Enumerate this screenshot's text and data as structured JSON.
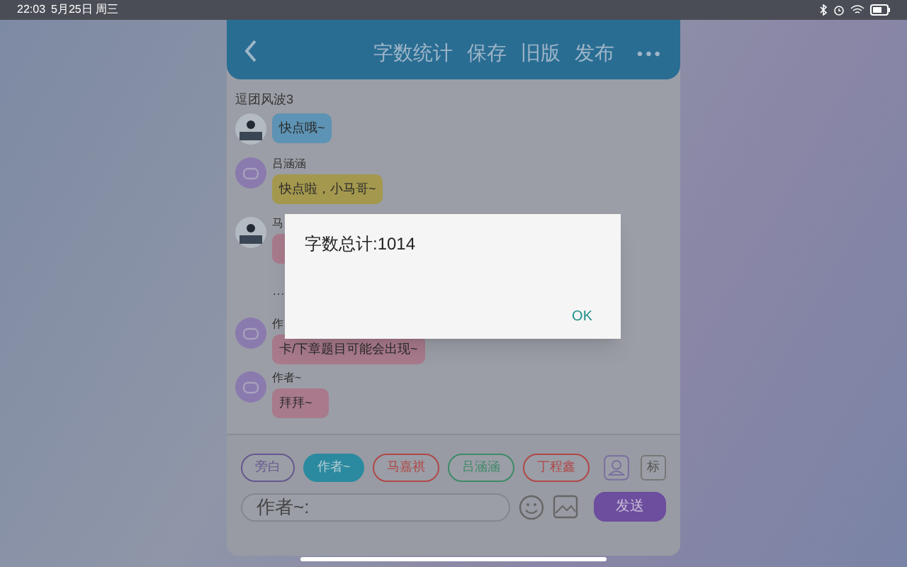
{
  "status_bar": {
    "time": "22:03",
    "date": "5月25日 周三"
  },
  "header": {
    "actions": [
      "字数统计",
      "保存",
      "旧版",
      "发布"
    ],
    "more": "•••"
  },
  "chat": {
    "title": "逗团风波3",
    "messages": [
      {
        "text": "快点哦~",
        "color": "#5d93b4"
      },
      {
        "kind": "icon",
        "name": "吕涵涵",
        "text": "快点啦，小马哥~",
        "color": "#a4984e"
      },
      {
        "name": "马",
        "color": "#a87a8c"
      },
      {
        "kind": "ellipsis",
        "text": "…"
      },
      {
        "kind": "icon",
        "name": "作",
        "text": "卡/下章题目可能会出现~",
        "color": "#a87a8c"
      },
      {
        "kind": "icon",
        "name": "作者~",
        "text": "拜拜~",
        "color": "#a87a8c"
      }
    ]
  },
  "roles": [
    {
      "label": "旁白",
      "color": "#66588f",
      "selected": false
    },
    {
      "label": "作者~",
      "color": "#2b8aa0",
      "selected": true
    },
    {
      "label": "马嘉祺",
      "color": "#b04848",
      "selected": false
    },
    {
      "label": "吕涵涵",
      "color": "#3f8a68",
      "selected": false
    },
    {
      "label": "丁程鑫",
      "color": "#b04848",
      "selected": false
    }
  ],
  "role_tag": "标",
  "input": {
    "value": "作者~:"
  },
  "send_button": "发送",
  "dialog": {
    "message": "字数总计:1014",
    "button": "OK"
  }
}
